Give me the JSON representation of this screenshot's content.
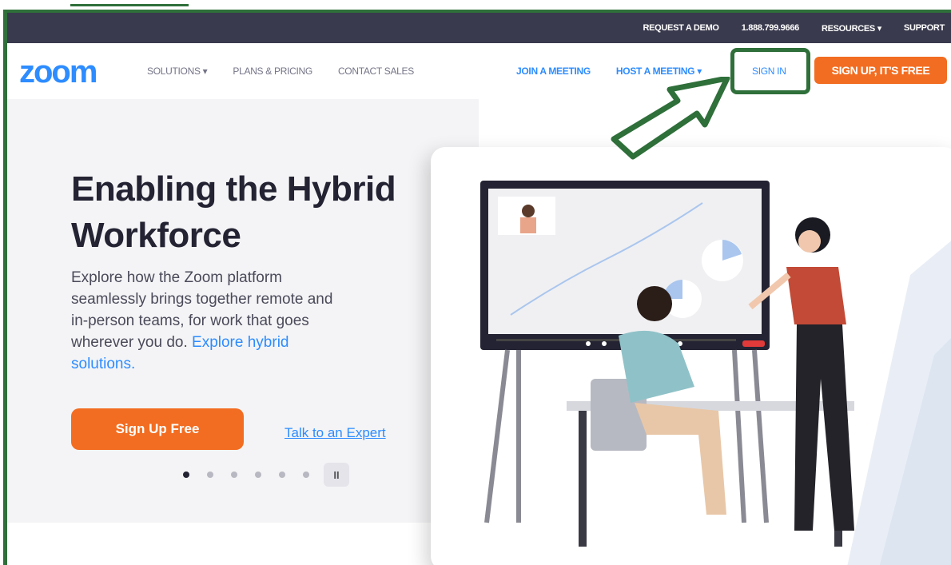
{
  "utility_bar": {
    "request_demo": "REQUEST A DEMO",
    "phone": "1.888.799.9666",
    "resources": "RESOURCES ▾",
    "support": "SUPPORT"
  },
  "nav": {
    "logo": "zoom",
    "solutions": "SOLUTIONS ▾",
    "plans_pricing": "PLANS & PRICING",
    "contact_sales": "CONTACT SALES",
    "join_meeting": "JOIN A MEETING",
    "host_meeting": "HOST A MEETING ▾",
    "sign_in": "SIGN IN",
    "sign_up": "SIGN UP, IT'S FREE"
  },
  "hero": {
    "headline": "Enabling the Hybrid Workforce",
    "description": "Explore how the Zoom platform seamlessly brings together remote and in-person teams, for work that goes wherever you do.",
    "description_link": "Explore hybrid solutions.",
    "cta_primary": "Sign Up Free",
    "cta_secondary": "Talk to an Expert",
    "pause_label": "II"
  },
  "colors": {
    "brand_blue": "#2d8cff",
    "brand_orange": "#f26d21",
    "highlight_green": "#2f6f3a",
    "utility_bg": "#3a3a4e"
  }
}
